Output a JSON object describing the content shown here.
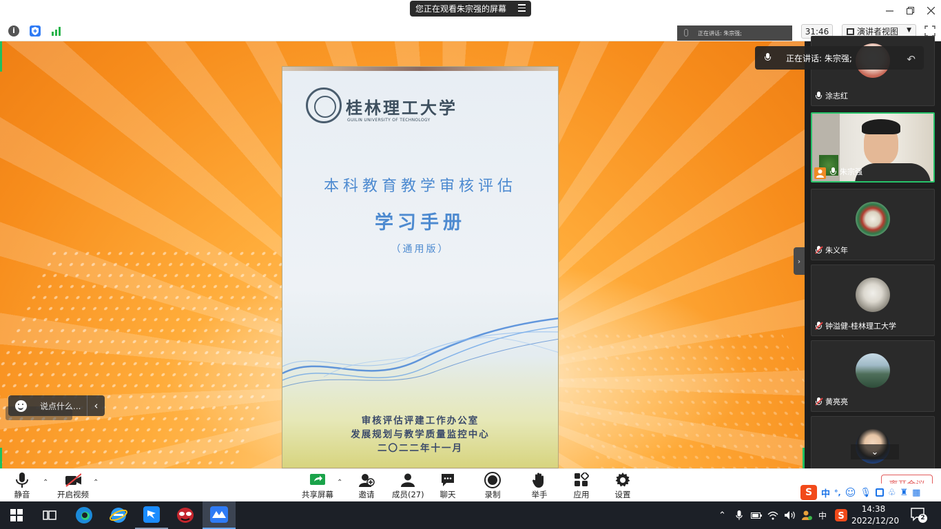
{
  "titlebar": {
    "share_notice": "您正在观看朱宗强的屏幕"
  },
  "subbar": {
    "timer": "31:46",
    "view_mode": "演讲者视图"
  },
  "shared_document": {
    "university_cn": "桂林理工大学",
    "university_en": "GUILIN UNIVERSITY OF TECHNOLOGY",
    "title_line1": "本科教育教学审核评估",
    "title_line2": "学习手册",
    "edition": "（通用版）",
    "footer_line1": "审核评估评建工作办公室",
    "footer_line2": "发展规划与教学质量监控中心",
    "footer_line3": "二〇二二年十一月"
  },
  "speaking_overlay_dim": "正在讲话: 朱宗强;",
  "speaking_banner": "正在讲话: 朱宗强;",
  "chat": {
    "placeholder": "说点什么..."
  },
  "participants": [
    {
      "name": "涂志红",
      "muted": false,
      "active": false
    },
    {
      "name": "朱宗强",
      "muted": false,
      "active": true
    },
    {
      "name": "朱义年",
      "muted": true,
      "active": false
    },
    {
      "name": "钟溢健-桂林理工大学",
      "muted": true,
      "active": false
    },
    {
      "name": "黄亮亮",
      "muted": true,
      "active": false
    },
    {
      "name": "",
      "muted": false,
      "active": false
    }
  ],
  "toolbar": {
    "mute_label": "静音",
    "video_label": "开启视频",
    "share_label": "共享屏幕",
    "invite_label": "邀请",
    "members_label": "成员(27)",
    "chat_label": "聊天",
    "record_label": "录制",
    "raise_hand_label": "举手",
    "apps_label": "应用",
    "settings_label": "设置",
    "leave_label": "离开会议"
  },
  "ime": {
    "lang": "中",
    "punct": "°,"
  },
  "taskbar": {
    "tray_lang": "中",
    "time": "14:38",
    "date": "2022/12/20",
    "notifications": "2"
  },
  "colors": {
    "active_green": "#27c36a",
    "leave_red": "#e35b5b",
    "doc_blue": "#4d8ad0"
  }
}
